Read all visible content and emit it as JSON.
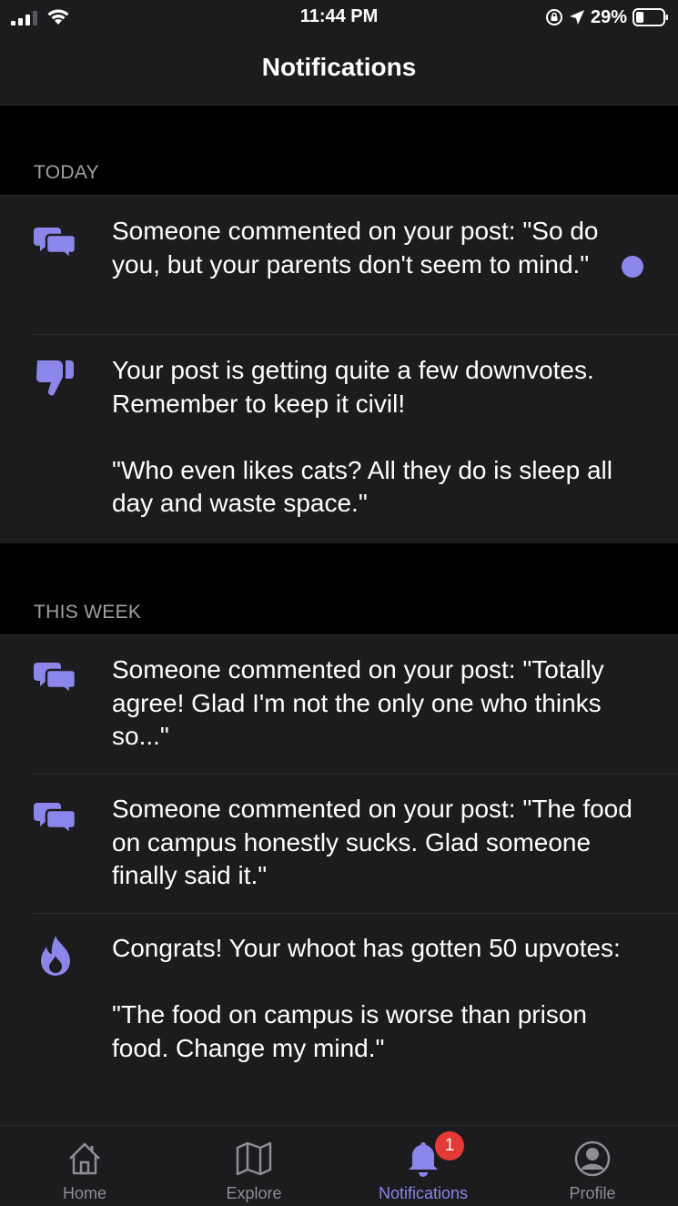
{
  "status_bar": {
    "time": "11:44 PM",
    "battery_percent": "29%",
    "battery_level": 0.29
  },
  "header": {
    "title": "Notifications"
  },
  "colors": {
    "accent": "#8a86ea",
    "badge": "#e53935",
    "background": "#1c1c1e",
    "section_bg": "#000000"
  },
  "sections": [
    {
      "label": "TODAY",
      "items": [
        {
          "icon": "comments-icon",
          "text": "Someone commented on your post: \"So do you, but your parents don't seem to mind.\"",
          "unread": true
        },
        {
          "icon": "thumbs-down-icon",
          "text": "Your post is getting quite a few downvotes. Remember to keep it civil!\n\n\"Who even likes cats? All they do is sleep all day and waste space.\"",
          "unread": false
        }
      ]
    },
    {
      "label": "THIS WEEK",
      "items": [
        {
          "icon": "comments-icon",
          "text": "Someone commented on your post: \"Totally agree! Glad I'm not the only one who thinks so...\"",
          "unread": false
        },
        {
          "icon": "comments-icon",
          "text": "Someone commented on your post: \"The food on campus honestly sucks. Glad someone finally said it.\"",
          "unread": false
        },
        {
          "icon": "fire-icon",
          "text": "Congrats! Your whoot has gotten 50 upvotes:\n\n\"The food on campus is worse than prison food. Change my mind.\"",
          "unread": false
        }
      ]
    }
  ],
  "tabs": [
    {
      "label": "Home",
      "icon": "home-icon"
    },
    {
      "label": "Explore",
      "icon": "map-icon"
    },
    {
      "label": "Notifications",
      "icon": "bell-icon",
      "active": true,
      "badge": "1"
    },
    {
      "label": "Profile",
      "icon": "profile-icon"
    }
  ]
}
